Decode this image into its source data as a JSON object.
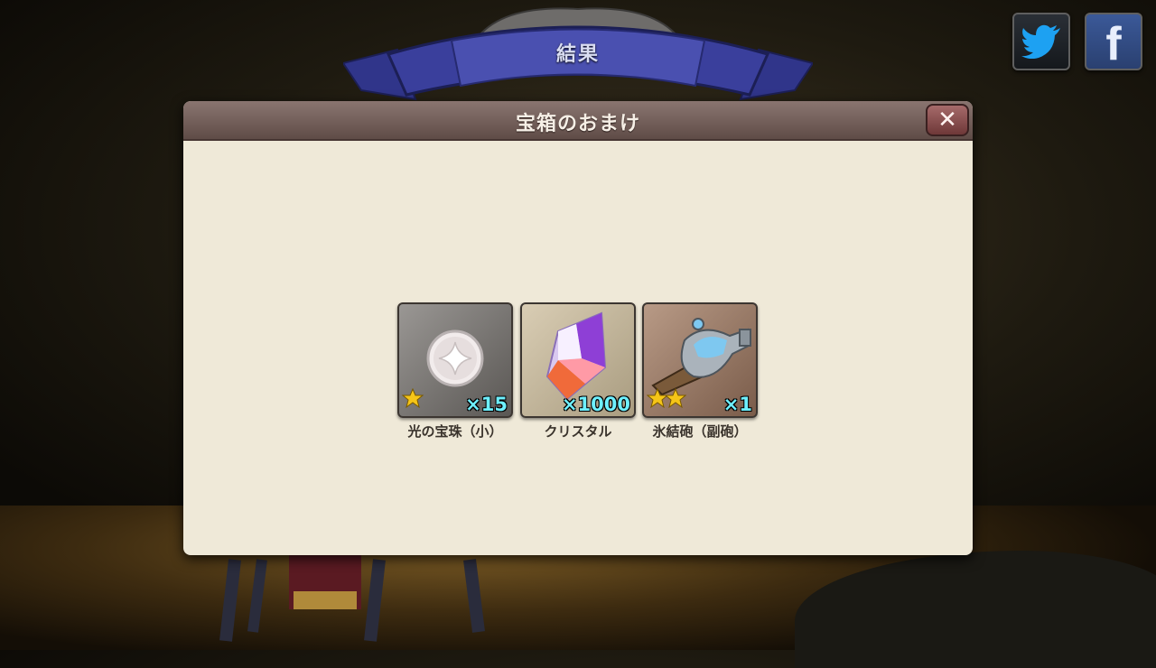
{
  "ribbon": {
    "title": "結果"
  },
  "social": {
    "twitter_icon": "twitter-bird-icon",
    "facebook_icon": "facebook-f-icon",
    "facebook_glyph": "f"
  },
  "dialog": {
    "title": "宝箱のおまけ",
    "close_icon": "close-icon",
    "close_glyph": "✕",
    "items": [
      {
        "name": "光の宝珠（小）",
        "quantity": "×15",
        "stars": 1,
        "icon": "light-orb-icon"
      },
      {
        "name": "クリスタル",
        "quantity": "×1000",
        "stars": 0,
        "icon": "crystal-icon"
      },
      {
        "name": "氷結砲（副砲）",
        "quantity": "×1",
        "stars": 2,
        "icon": "ice-cannon-icon"
      }
    ]
  },
  "colors": {
    "dialog_bg": "#efe9d8",
    "header": "#6f5b56",
    "quantity_text": "#6ef0ff",
    "ribbon": "#3a3f9c"
  }
}
